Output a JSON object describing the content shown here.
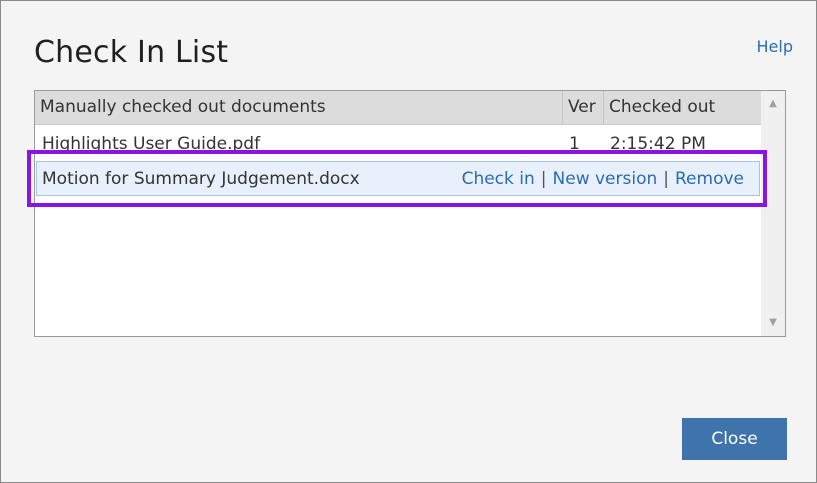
{
  "dialog": {
    "title": "Check In List",
    "help_label": "Help",
    "close_label": "Close"
  },
  "table": {
    "columns": [
      "Manually checked out documents",
      "Ver",
      "Checked out"
    ],
    "rows": [
      {
        "name": "Highlights User Guide.pdf",
        "ver": "1",
        "checked_out": "2:15:42 PM"
      },
      {
        "name": "Motion for Summary Judgement.docx",
        "actions": [
          "Check in",
          "New version",
          "Remove"
        ],
        "separator": "|"
      }
    ]
  },
  "scroll": {
    "up_icon": "chevron-up-icon",
    "down_icon": "chevron-down-icon"
  },
  "colors": {
    "accent": "#3f73ac",
    "link": "#2b6cb0",
    "highlight_border": "#8a14e6",
    "selected_row": "#e8f1fb"
  }
}
